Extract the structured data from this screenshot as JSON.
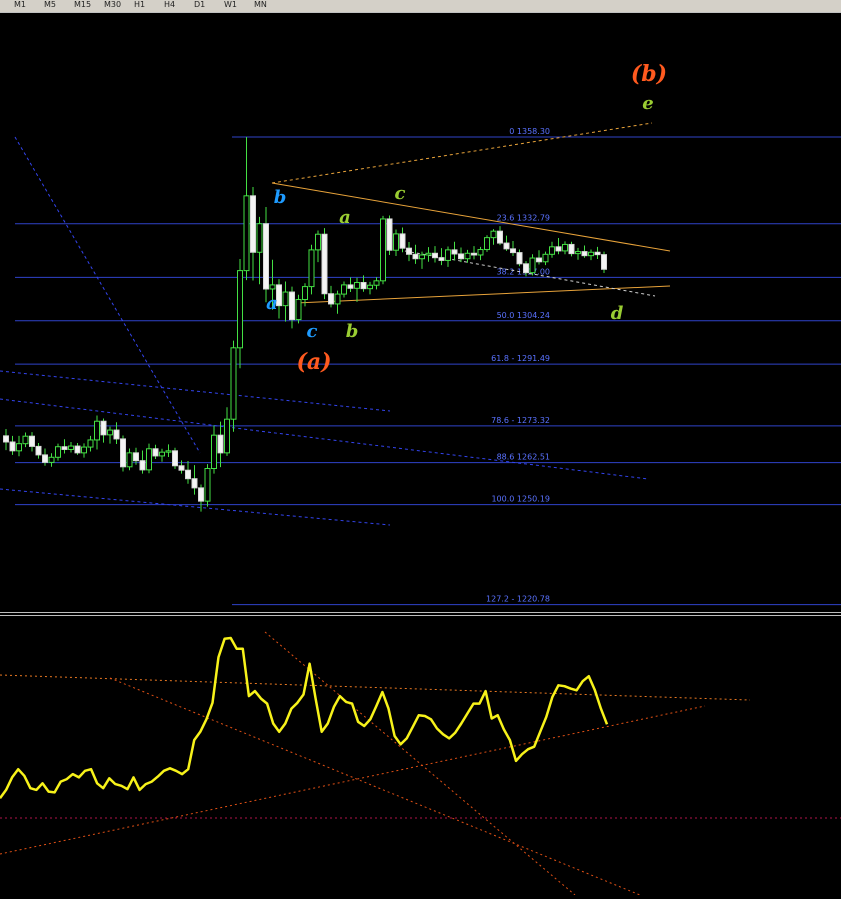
{
  "toolbar": {
    "timeframes": [
      "M1",
      "M5",
      "M15",
      "M30",
      "H1",
      "H4",
      "D1",
      "W1",
      "MN"
    ]
  },
  "chart_data": [
    {
      "type": "candlestick",
      "fibonacci_levels": [
        {
          "label": "0 1358.30",
          "price": 1358.3
        },
        {
          "label": "23.6 1332.79",
          "price": 1332.79
        },
        {
          "label": "38.2 1317.00",
          "price": 1317.0
        },
        {
          "label": "50.0 1304.24",
          "price": 1304.24
        },
        {
          "label": "61.8 - 1291.49",
          "price": 1291.49
        },
        {
          "label": "78.6 - 1273.32",
          "price": 1273.32
        },
        {
          "label": "88.6 1262.51",
          "price": 1262.51
        },
        {
          "label": "100.0 1250.19",
          "price": 1250.19
        },
        {
          "label": "127.2 - 1220.78",
          "price": 1220.78
        }
      ],
      "wave_labels": [
        {
          "text": "(b)",
          "color": "#ff5a1f"
        },
        {
          "text": "e",
          "color": "#9acd32"
        },
        {
          "text": "b",
          "color": "#1e9bff"
        },
        {
          "text": "a",
          "color": "#9acd32"
        },
        {
          "text": "c",
          "color": "#9acd32"
        },
        {
          "text": "a",
          "color": "#1e9bff"
        },
        {
          "text": "c",
          "color": "#1e9bff"
        },
        {
          "text": "b",
          "color": "#9acd32"
        },
        {
          "text": "(a)",
          "color": "#ff5a1f"
        },
        {
          "text": "d",
          "color": "#9acd32"
        }
      ],
      "candles": [
        [
          1270.4,
          1272.4,
          1266.2,
          1268.6
        ],
        [
          1268.6,
          1270.4,
          1264.8,
          1266.0
        ],
        [
          1266.0,
          1270.4,
          1264.4,
          1268.1
        ],
        [
          1268.1,
          1271.4,
          1267.1,
          1270.3
        ],
        [
          1270.3,
          1271.5,
          1265.8,
          1267.3
        ],
        [
          1267.3,
          1268.3,
          1263.7,
          1264.8
        ],
        [
          1264.8,
          1266.7,
          1261.6,
          1262.6
        ],
        [
          1262.6,
          1265.3,
          1261.3,
          1264.1
        ],
        [
          1264.1,
          1268.1,
          1263.1,
          1267.2
        ],
        [
          1267.2,
          1269.4,
          1265.2,
          1266.4
        ],
        [
          1266.4,
          1268.6,
          1265.5,
          1267.4
        ],
        [
          1267.4,
          1268.3,
          1264.8,
          1265.4
        ],
        [
          1265.4,
          1268.2,
          1264.0,
          1267.1
        ],
        [
          1267.1,
          1270.4,
          1265.8,
          1269.2
        ],
        [
          1269.2,
          1276.4,
          1266.4,
          1274.7
        ],
        [
          1274.7,
          1275.5,
          1268.4,
          1270.7
        ],
        [
          1270.7,
          1273.1,
          1268.1,
          1272.1
        ],
        [
          1272.1,
          1274.4,
          1268.0,
          1269.5
        ],
        [
          1269.5,
          1270.5,
          1259.9,
          1261.3
        ],
        [
          1261.3,
          1266.7,
          1260.3,
          1265.4
        ],
        [
          1265.4,
          1266.9,
          1261.9,
          1263.1
        ],
        [
          1263.1,
          1266.1,
          1259.3,
          1260.4
        ],
        [
          1260.4,
          1268.1,
          1259.4,
          1266.6
        ],
        [
          1266.6,
          1267.8,
          1263.6,
          1264.5
        ],
        [
          1264.5,
          1266.6,
          1262.8,
          1265.6
        ],
        [
          1265.6,
          1267.9,
          1264.2,
          1266.0
        ],
        [
          1266.0,
          1266.9,
          1260.7,
          1261.6
        ],
        [
          1261.6,
          1263.2,
          1259.3,
          1260.3
        ],
        [
          1260.3,
          1263.0,
          1256.3,
          1257.8
        ],
        [
          1257.8,
          1261.8,
          1253.1,
          1255.1
        ],
        [
          1255.1,
          1256.1,
          1248.1,
          1251.2
        ],
        [
          1251.2,
          1262.1,
          1249.6,
          1260.8
        ],
        [
          1260.8,
          1273.5,
          1259.3,
          1270.6
        ],
        [
          1270.6,
          1274.6,
          1261.2,
          1265.4
        ],
        [
          1265.4,
          1278.8,
          1264.5,
          1275.3
        ],
        [
          1275.3,
          1298.4,
          1271.6,
          1296.3
        ],
        [
          1296.3,
          1322.4,
          1290.3,
          1319.0
        ],
        [
          1319.0,
          1358.3,
          1316.2,
          1341.0
        ],
        [
          1341.0,
          1343.6,
          1316.1,
          1324.4
        ],
        [
          1324.4,
          1334.8,
          1315.0,
          1332.8
        ],
        [
          1332.8,
          1337.7,
          1309.7,
          1313.6
        ],
        [
          1313.6,
          1322.2,
          1307.5,
          1314.8
        ],
        [
          1314.8,
          1316.5,
          1304.9,
          1308.7
        ],
        [
          1308.7,
          1315.8,
          1304.0,
          1312.7
        ],
        [
          1312.7,
          1314.3,
          1302.0,
          1304.6
        ],
        [
          1304.6,
          1311.9,
          1303.5,
          1310.5
        ],
        [
          1310.5,
          1315.3,
          1308.5,
          1314.3
        ],
        [
          1314.3,
          1326.6,
          1312.0,
          1325.1
        ],
        [
          1325.1,
          1330.8,
          1321.5,
          1329.7
        ],
        [
          1329.7,
          1331.5,
          1310.6,
          1312.2
        ],
        [
          1312.2,
          1314.5,
          1308.2,
          1309.2
        ],
        [
          1309.2,
          1313.1,
          1306.3,
          1312.1
        ],
        [
          1312.1,
          1315.8,
          1311.1,
          1314.8
        ],
        [
          1314.8,
          1317.0,
          1312.7,
          1313.8
        ],
        [
          1313.8,
          1316.9,
          1309.8,
          1315.5
        ],
        [
          1315.5,
          1317.6,
          1312.8,
          1313.7
        ],
        [
          1313.7,
          1315.7,
          1312.0,
          1314.7
        ],
        [
          1314.7,
          1317.1,
          1313.5,
          1316.0
        ],
        [
          1316.0,
          1335.1,
          1315.0,
          1334.2
        ],
        [
          1334.2,
          1335.2,
          1323.6,
          1325.0
        ],
        [
          1325.0,
          1331.1,
          1323.3,
          1329.8
        ],
        [
          1329.8,
          1331.7,
          1324.4,
          1325.6
        ],
        [
          1325.6,
          1327.4,
          1321.8,
          1323.8
        ],
        [
          1323.8,
          1326.6,
          1321.0,
          1322.5
        ],
        [
          1322.5,
          1324.6,
          1319.5,
          1323.6
        ],
        [
          1323.6,
          1325.9,
          1321.6,
          1324.1
        ],
        [
          1324.1,
          1326.2,
          1321.4,
          1322.8
        ],
        [
          1322.8,
          1325.6,
          1320.6,
          1322.0
        ],
        [
          1322.0,
          1326.1,
          1320.1,
          1325.1
        ],
        [
          1325.1,
          1327.5,
          1322.0,
          1323.9
        ],
        [
          1323.9,
          1325.8,
          1321.5,
          1322.5
        ],
        [
          1322.5,
          1325.1,
          1321.3,
          1324.1
        ],
        [
          1324.1,
          1326.2,
          1322.3,
          1323.6
        ],
        [
          1323.6,
          1326.0,
          1322.1,
          1325.2
        ],
        [
          1325.2,
          1329.4,
          1324.5,
          1328.7
        ],
        [
          1328.7,
          1331.2,
          1326.6,
          1330.6
        ],
        [
          1330.6,
          1332.1,
          1326.5,
          1327.1
        ],
        [
          1327.1,
          1329.3,
          1324.8,
          1325.4
        ],
        [
          1325.4,
          1327.7,
          1323.3,
          1324.3
        ],
        [
          1324.3,
          1325.2,
          1320.3,
          1321.0
        ],
        [
          1321.0,
          1321.8,
          1317.3,
          1318.4
        ],
        [
          1318.4,
          1323.8,
          1317.6,
          1322.7
        ],
        [
          1322.7,
          1325.0,
          1320.8,
          1321.6
        ],
        [
          1321.6,
          1324.6,
          1320.6,
          1323.8
        ],
        [
          1323.8,
          1327.5,
          1322.8,
          1326.0
        ],
        [
          1326.0,
          1328.6,
          1323.8,
          1324.8
        ],
        [
          1324.8,
          1327.6,
          1323.8,
          1326.7
        ],
        [
          1326.7,
          1327.5,
          1323.2,
          1324.0
        ],
        [
          1324.0,
          1325.7,
          1322.2,
          1324.6
        ],
        [
          1324.6,
          1326.4,
          1322.8,
          1323.4
        ],
        [
          1323.4,
          1325.2,
          1322.1,
          1324.4
        ],
        [
          1324.4,
          1326.0,
          1322.4,
          1323.7
        ],
        [
          1323.7,
          1324.6,
          1318.3,
          1319.4
        ]
      ]
    },
    {
      "type": "line",
      "series": [
        {
          "values": [
            60,
            70,
            85,
            95,
            87,
            72,
            70,
            78,
            68,
            67,
            80,
            83,
            89,
            85,
            93,
            95,
            78,
            72,
            84,
            77,
            75,
            71,
            85,
            70,
            77,
            80,
            86,
            93,
            96,
            93,
            89,
            95,
            130,
            140,
            155,
            175,
            230,
            252,
            253,
            240,
            240,
            183,
            189,
            180,
            174,
            150,
            140,
            150,
            168,
            175,
            185,
            222,
            180,
            140,
            150,
            170,
            183,
            176,
            174,
            152,
            147,
            155,
            171,
            188,
            168,
            135,
            125,
            132,
            146,
            160,
            159,
            155,
            144,
            137,
            132,
            139,
            150,
            162,
            174,
            174,
            189,
            156,
            160,
            143,
            130,
            105,
            113,
            119,
            122,
            140,
            158,
            182,
            196,
            195,
            192,
            190,
            201,
            207,
            190,
            168,
            149
          ]
        }
      ]
    }
  ]
}
